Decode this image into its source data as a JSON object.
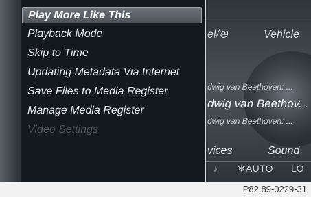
{
  "menu": {
    "items": [
      {
        "label": "Play More Like This",
        "state": "selected"
      },
      {
        "label": "Playback Mode",
        "state": "normal"
      },
      {
        "label": "Skip to Time",
        "state": "normal"
      },
      {
        "label": "Updating Metadata Via Internet",
        "state": "normal"
      },
      {
        "label": "Save Files to Media Register",
        "state": "normal"
      },
      {
        "label": "Manage Media Register",
        "state": "normal"
      },
      {
        "label": "Video Settings",
        "state": "disabled"
      }
    ]
  },
  "background": {
    "tabs": {
      "left_partial": "el/⊕",
      "vehicle": "Vehicle"
    },
    "track_lines": {
      "line1": "dwig van Beethoven: ...",
      "line2": "dwig van Beethov...",
      "line3": "dwig van Beethoven: ..."
    },
    "bottom_tabs": {
      "vices": "vices",
      "sound": "Sound"
    },
    "status": {
      "climate": "❄AUTO",
      "lo": "LO"
    }
  },
  "footer": {
    "reference": "P82.89-0229-31"
  }
}
